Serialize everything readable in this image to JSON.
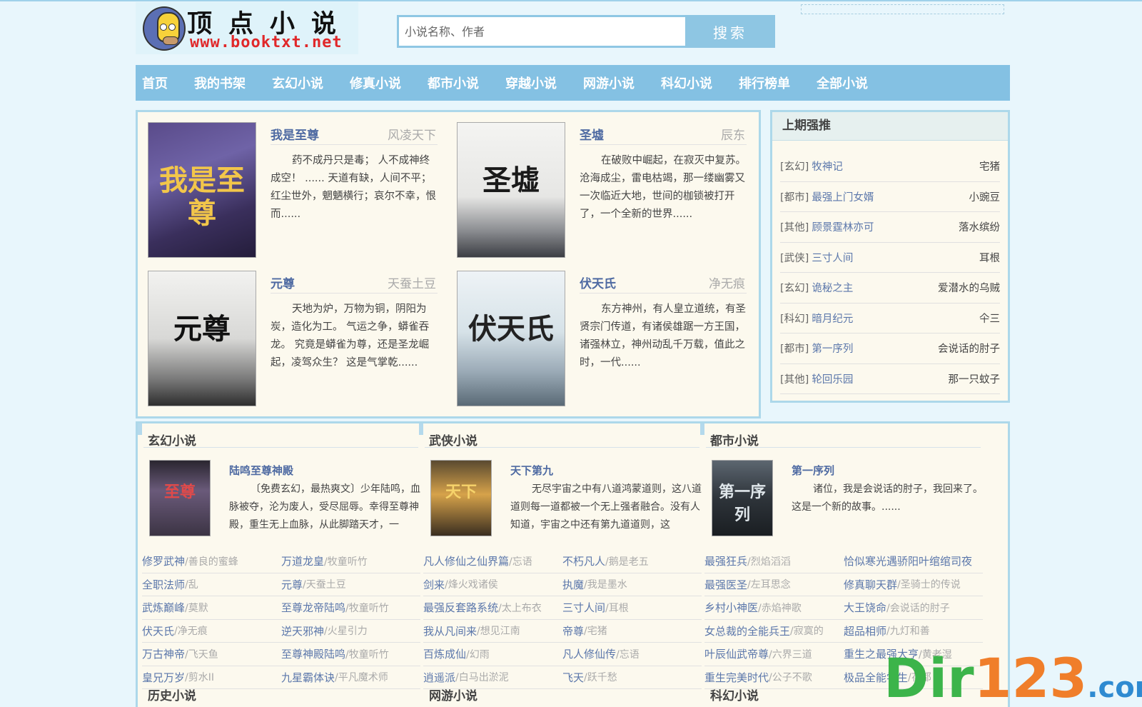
{
  "header": {
    "logo_title": "顶点小说",
    "logo_url": "www.booktxt.net"
  },
  "search": {
    "placeholder": "小说名称、作者",
    "button_label": "搜索"
  },
  "nav": [
    "首页",
    "我的书架",
    "玄幻小说",
    "修真小说",
    "都市小说",
    "穿越小说",
    "网游小说",
    "科幻小说",
    "排行榜单",
    "全部小说"
  ],
  "featured": [
    {
      "title": "我是至尊",
      "author": "风凌天下",
      "desc": "药不成丹只是毒； 人不成神终成空！ ...... 天道有缺，人间不平；红尘世外，魍魉横行；哀尔不幸，恨而......",
      "cover_text": "我是至尊"
    },
    {
      "title": "圣墟",
      "author": "辰东",
      "desc": "在破败中崛起，在寂灭中复苏。 沧海成尘，雷电枯竭，那一缕幽雾又一次临近大地，世间的枷锁被打开了，一个全新的世界......",
      "cover_text": "圣墟"
    },
    {
      "title": "元尊",
      "author": "天蚕土豆",
      "desc": "天地为炉，万物为铜，阴阳为炭，造化为工。 气运之争，蟒雀吞龙。 究竟是蟒雀为尊，还是圣龙崛起，凌驾众生？ 这是气掌乾......",
      "cover_text": "元尊"
    },
    {
      "title": "伏天氏",
      "author": "净无痕",
      "desc": "东方神州，有人皇立道统，有圣贤宗门传道，有诸侯雄踞一方王国，诸强林立，神州动乱千万载，值此之时，一代......",
      "cover_text": "伏天氏"
    }
  ],
  "recommend": {
    "title": "上期强推",
    "items": [
      {
        "cat": "[玄幻]",
        "name": "牧神记",
        "author": "宅猪"
      },
      {
        "cat": "[都市]",
        "name": "最强上门女婿",
        "author": "小豌豆"
      },
      {
        "cat": "[其他]",
        "name": "顾景霆林亦可",
        "author": "落水缤纷"
      },
      {
        "cat": "[武侠]",
        "name": "三寸人间",
        "author": "耳根"
      },
      {
        "cat": "[玄幻]",
        "name": "诡秘之主",
        "author": "爱潜水的乌贼"
      },
      {
        "cat": "[科幻]",
        "name": "暗月纪元",
        "author": "仐三"
      },
      {
        "cat": "[都市]",
        "name": "第一序列",
        "author": "会说话的肘子"
      },
      {
        "cat": "[其他]",
        "name": "轮回乐园",
        "author": "那一只蚊子"
      }
    ]
  },
  "categories": [
    {
      "name": "玄幻小说",
      "cover_text": "至尊",
      "book_title": "陆鸣至尊神殿",
      "book_desc": "〔免费玄幻，最热爽文〕少年陆鸣，血脉被夺，沦为废人，受尽屈辱。幸得至尊神殿，重生无上血脉，从此脚踏天才，一",
      "list": [
        {
          "t": "修罗武神",
          "a": "/善良的蜜蜂"
        },
        {
          "t": "万道龙皇",
          "a": "/牧童听竹"
        },
        {
          "t": "全职法师",
          "a": "/乱"
        },
        {
          "t": "元尊",
          "a": "/天蚕土豆"
        },
        {
          "t": "武炼巅峰",
          "a": "/莫默"
        },
        {
          "t": "至尊龙帝陆鸣",
          "a": "/牧童听竹"
        },
        {
          "t": "伏天氏",
          "a": "/净无痕"
        },
        {
          "t": "逆天邪神",
          "a": "/火星引力"
        },
        {
          "t": "万古神帝",
          "a": "/飞天鱼"
        },
        {
          "t": "至尊神殿陆鸣",
          "a": "/牧童听竹"
        },
        {
          "t": "皇兄万岁",
          "a": "/剪水II"
        },
        {
          "t": "九星霸体诀",
          "a": "/平凡魔术师"
        }
      ],
      "footer": "历史小说"
    },
    {
      "name": "武侠小说",
      "cover_text": "天下",
      "book_title": "天下第九",
      "book_desc": "无尽宇宙之中有八道鸿蒙道则，这八道道则每一道都被一个无上强者融合。没有人知道，宇宙之中还有第九道道则，这",
      "list": [
        {
          "t": "凡人修仙之仙界篇",
          "a": "/忘语"
        },
        {
          "t": "不朽凡人",
          "a": "/鹅是老五"
        },
        {
          "t": "剑来",
          "a": "/烽火戏诸侯"
        },
        {
          "t": "执魔",
          "a": "/我是墨水"
        },
        {
          "t": "最强反套路系统",
          "a": "/太上布衣"
        },
        {
          "t": "三寸人间",
          "a": "/耳根"
        },
        {
          "t": "我从凡间来",
          "a": "/想见江南"
        },
        {
          "t": "帝尊",
          "a": "/宅猪"
        },
        {
          "t": "百炼成仙",
          "a": "/幻雨"
        },
        {
          "t": "凡人修仙传",
          "a": "/忘语"
        },
        {
          "t": "逍遥派",
          "a": "/白马出淤泥"
        },
        {
          "t": "飞天",
          "a": "/跃千愁"
        }
      ],
      "footer": "网游小说"
    },
    {
      "name": "都市小说",
      "cover_text": "第一序列",
      "book_title": "第一序列",
      "book_desc": "诸位，我是会说话的肘子，我回来了。 这是一个新的故事。......",
      "list": [
        {
          "t": "最强狂兵",
          "a": "/烈焰滔滔"
        },
        {
          "t": "恰似寒光遇骄阳叶绾绾司夜",
          "a": ""
        },
        {
          "t": "最强医圣",
          "a": "/左耳思念"
        },
        {
          "t": "修真聊天群",
          "a": "/圣骑士的传说"
        },
        {
          "t": "乡村小神医",
          "a": "/赤焰神歌"
        },
        {
          "t": "大王饶命",
          "a": "/会说话的肘子"
        },
        {
          "t": "女总裁的全能兵王",
          "a": "/寂寞的"
        },
        {
          "t": "超品相师",
          "a": "/九灯和善"
        },
        {
          "t": "叶辰仙武帝尊",
          "a": "/六界三道"
        },
        {
          "t": "重生之最强大亨",
          "a": "/黄老湿"
        },
        {
          "t": "重生完美时代",
          "a": "/公子不歌"
        },
        {
          "t": "极品全能学生",
          "a": "/花都"
        }
      ],
      "footer": "科幻小说"
    }
  ],
  "watermark": {
    "dir": "Dir",
    "num": "123",
    "com": ".com"
  }
}
